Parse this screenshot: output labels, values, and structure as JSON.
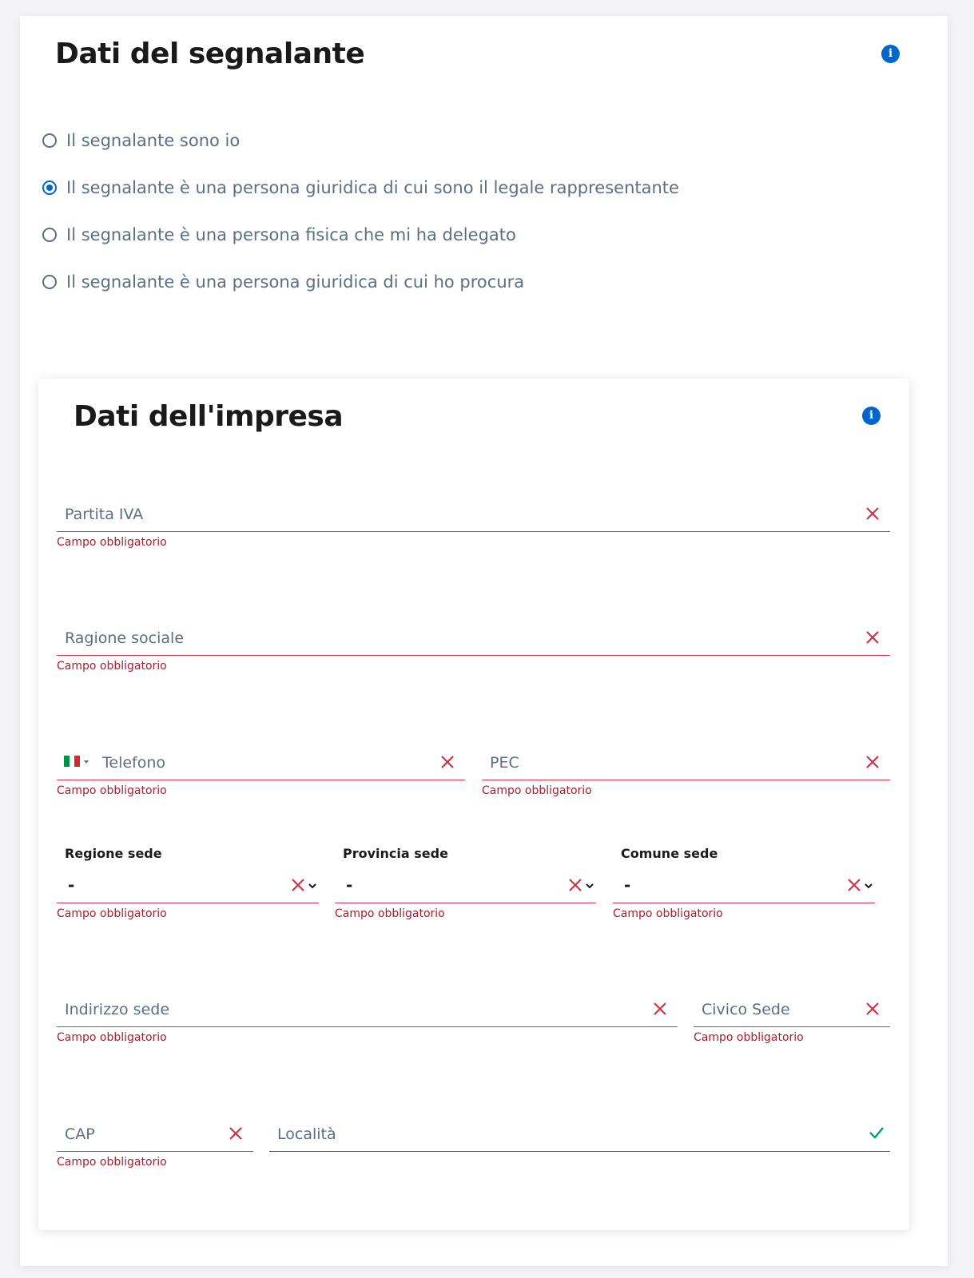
{
  "reporter": {
    "title": "Dati del segnalante",
    "options": [
      {
        "label": "Il segnalante sono io",
        "checked": false
      },
      {
        "label": "Il segnalante è una persona giuridica di cui sono il legale rappresentante",
        "checked": true
      },
      {
        "label": "Il segnalante è una persona fisica che mi ha delegato",
        "checked": false
      },
      {
        "label": "Il segnalante è una persona giuridica di cui ho procura",
        "checked": false
      }
    ]
  },
  "company": {
    "title": "Dati dell'impresa",
    "fields": {
      "partita_iva": {
        "placeholder": "Partita IVA",
        "error": "Campo obbligatorio"
      },
      "ragione_sociale": {
        "placeholder": "Ragione sociale",
        "error": "Campo obbligatorio"
      },
      "telefono": {
        "placeholder": "Telefono",
        "error": "Campo obbligatorio",
        "country": "IT"
      },
      "pec": {
        "placeholder": "PEC",
        "error": "Campo obbligatorio"
      },
      "regione": {
        "label": "Regione sede",
        "value": "-",
        "error": "Campo obbligatorio"
      },
      "provincia": {
        "label": "Provincia sede",
        "value": "-",
        "error": "Campo obbligatorio"
      },
      "comune": {
        "label": "Comune sede",
        "value": "-",
        "error": "Campo obbligatorio"
      },
      "indirizzo": {
        "placeholder": "Indirizzo sede",
        "error": "Campo obbligatorio"
      },
      "civico": {
        "placeholder": "Civico Sede",
        "error": "Campo obbligatorio"
      },
      "cap": {
        "placeholder": "CAP",
        "error": "Campo obbligatorio"
      },
      "localita": {
        "placeholder": "Località",
        "valid": true
      }
    }
  },
  "colors": {
    "primary": "#0066cc",
    "error": "#cc334d",
    "error_text": "#a32030",
    "valid": "#1f6f5c",
    "muted_text": "#5c6f82"
  },
  "icons": {
    "info": "info-icon",
    "clear": "close-icon",
    "valid": "check-icon",
    "dropdown": "chevron-down-icon",
    "flag": "italy-flag-icon"
  }
}
